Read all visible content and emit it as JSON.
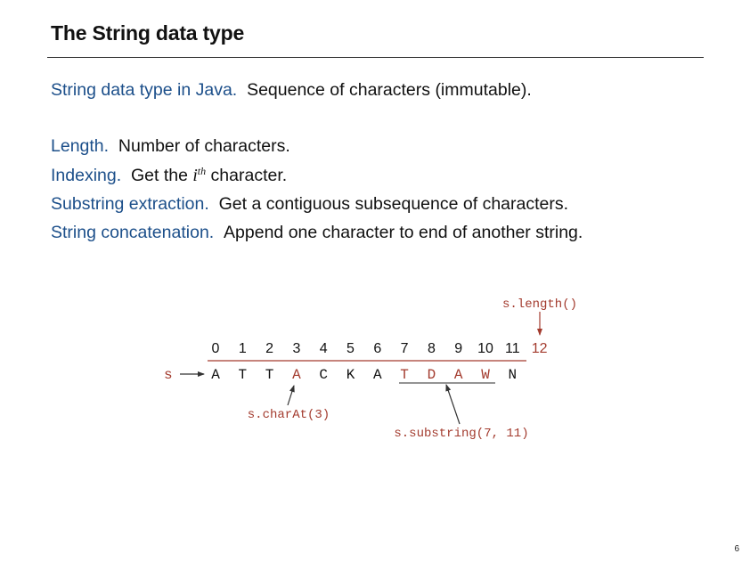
{
  "title": "The String data type",
  "lines": [
    {
      "term": "String data type in Java.",
      "desc": "Sequence of characters (immutable)."
    },
    {
      "term": "Length.",
      "desc": "Number of characters."
    },
    {
      "term": "Indexing.",
      "desc_before": "Get the ",
      "sup_base": "i",
      "sup": "th",
      "desc_after": " character."
    },
    {
      "term": "Substring extraction.",
      "desc": "Get a contiguous subsequence of characters."
    },
    {
      "term": "String concatenation.",
      "desc": "Append one character to end of another string."
    }
  ],
  "diagram": {
    "variable": "s",
    "indices": [
      "0",
      "1",
      "2",
      "3",
      "4",
      "5",
      "6",
      "7",
      "8",
      "9",
      "10",
      "11",
      "12"
    ],
    "characters": [
      "A",
      "T",
      "T",
      "A",
      "C",
      "K",
      "A",
      "T",
      "D",
      "A",
      "W",
      "N"
    ],
    "highlight_char_index": 3,
    "highlight_range": [
      7,
      11
    ],
    "length_label": "s.length()",
    "charat_label": "s.charAt(3)",
    "substring_label": "s.substring(7, 11)",
    "colors": {
      "accent": "#a33b2e",
      "text": "#111111",
      "term": "#1c4f8a"
    }
  },
  "page_number": "6"
}
